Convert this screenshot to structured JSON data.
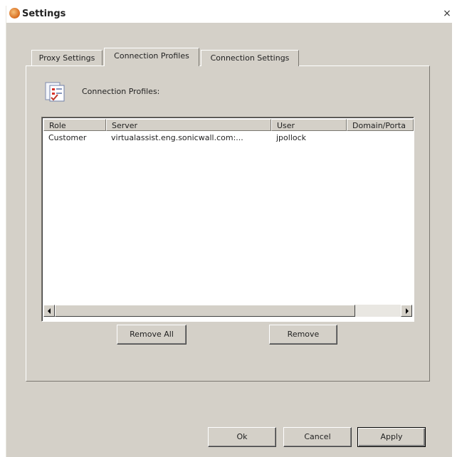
{
  "window": {
    "title": "Settings",
    "close_glyph": "×"
  },
  "tabs": [
    {
      "label": "Proxy Settings",
      "active": false
    },
    {
      "label": "Connection Profiles",
      "active": true
    },
    {
      "label": "Connection Settings",
      "active": false
    }
  ],
  "profiles": {
    "section_label": "Connection Profiles:",
    "icon": "profiles-icon",
    "columns": [
      "Role",
      "Server",
      "User",
      "Domain/Porta"
    ],
    "rows": [
      {
        "role": "Customer",
        "server": "virtualassist.eng.sonicwall.com:...",
        "user": "jpollock",
        "domain": ""
      }
    ],
    "remove_all_label": "Remove All",
    "remove_label": "Remove"
  },
  "footer": {
    "ok_label": "Ok",
    "cancel_label": "Cancel",
    "apply_label": "Apply"
  },
  "colors": {
    "face": "#d4d0c8",
    "accent_icon": "#d76a1c"
  }
}
